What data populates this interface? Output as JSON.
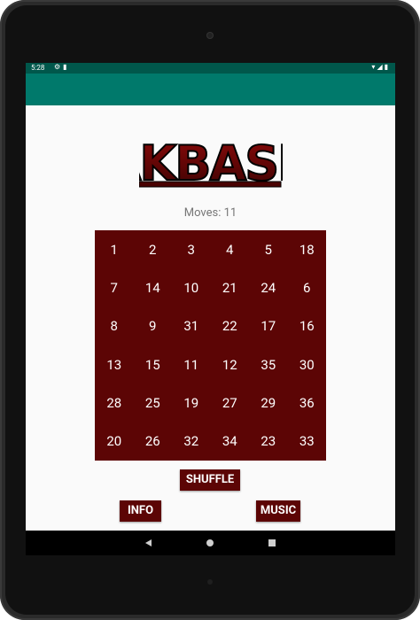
{
  "status_bar": {
    "time": "5:28",
    "right_icons": [
      "wifi-icon",
      "signal-icon",
      "battery-icon"
    ]
  },
  "app": {
    "title": "",
    "logo_text": "AKBASH"
  },
  "moves": {
    "label": "Moves: 11"
  },
  "grid": {
    "rows": [
      [
        "1",
        "2",
        "3",
        "4",
        "5",
        "18"
      ],
      [
        "7",
        "14",
        "10",
        "21",
        "24",
        "6"
      ],
      [
        "8",
        "9",
        "31",
        "22",
        "17",
        "16"
      ],
      [
        "13",
        "15",
        "11",
        "12",
        "35",
        "30"
      ],
      [
        "28",
        "25",
        "19",
        "27",
        "29",
        "36"
      ],
      [
        "20",
        "26",
        "32",
        "34",
        "23",
        "33"
      ]
    ]
  },
  "buttons": {
    "shuffle": "SHUFFLE",
    "info": "INFO",
    "music": "MUSIC"
  },
  "nav_bar": {
    "back_icon": "back-icon",
    "home_icon": "home-icon",
    "recent_icon": "recent-apps-icon"
  },
  "colors": {
    "primary": "#00796b",
    "status": "#00574b",
    "accent": "#5c0505"
  }
}
